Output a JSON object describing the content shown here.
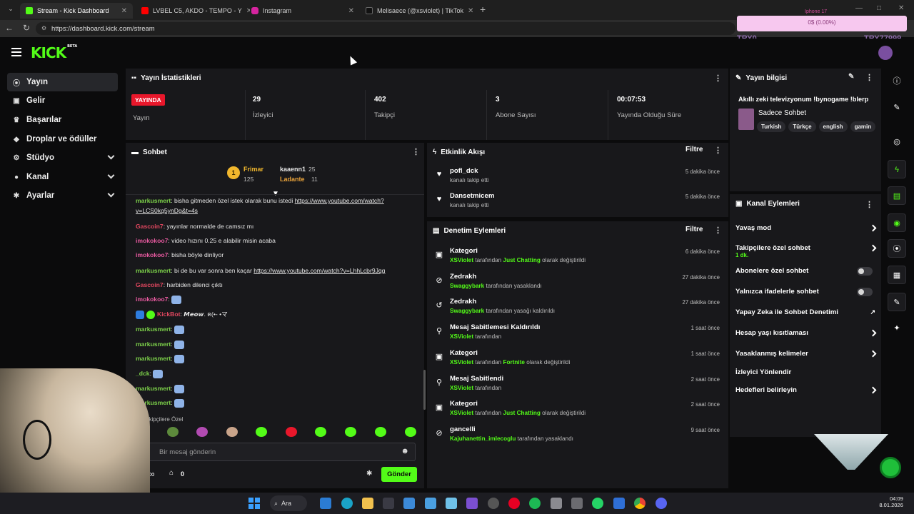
{
  "browser": {
    "tabs": [
      {
        "title": "Stream - Kick Dashboard",
        "active": true
      },
      {
        "title": "LVBEL C5, AKDO - TEMPO - Y",
        "active": false
      },
      {
        "title": "Instagram",
        "active": false
      },
      {
        "title": "Melisaece (@xsviolet) | TikTok",
        "active": false
      }
    ],
    "url": "https://dashboard.kick.com/stream"
  },
  "overlay": {
    "top_label": "Iphone 17",
    "progress_text": "0$ (0.00%)",
    "progress": 0,
    "left_name": "TRY0",
    "right_name": "TRY77999"
  },
  "app": {
    "logo": "KICK",
    "logo_badge": "BETA"
  },
  "sidebar": {
    "items": [
      {
        "label": "Yayın",
        "icon": "broadcast-icon",
        "active": true
      },
      {
        "label": "Gelir",
        "icon": "money-icon"
      },
      {
        "label": "Başarılar",
        "icon": "trophy-icon"
      },
      {
        "label": "Droplar ve ödüller",
        "icon": "gift-icon"
      },
      {
        "label": "Stüdyo",
        "icon": "studio-icon",
        "expandable": true
      },
      {
        "label": "Kanal",
        "icon": "person-icon",
        "expandable": true
      },
      {
        "label": "Ayarlar",
        "icon": "gear-icon",
        "expandable": true
      }
    ]
  },
  "stats": {
    "title": "Yayın İstatistikleri",
    "live_badge": "YAYINDA",
    "live_label": "Yayın",
    "items": [
      {
        "value": "29",
        "label": "İzleyici"
      },
      {
        "value": "402",
        "label": "Takipçi"
      },
      {
        "value": "3",
        "label": "Abone Sayısı"
      },
      {
        "value": "00:07:53",
        "label": "Yayında Olduğu Süre"
      }
    ]
  },
  "chat": {
    "title": "Sohbet",
    "leaderboard": [
      {
        "rank": "1",
        "name": "Frimar",
        "count": "125"
      },
      {
        "name": "kaaenn1",
        "count": "25"
      },
      {
        "name": "Ladante",
        "count": "11"
      }
    ],
    "messages": [
      {
        "user": "markusmert",
        "color": "#7dd24a",
        "text": "bisha gitmeden özel istek olarak bunu istedi ",
        "link": "https://www.youtube.com/watch?v=LCS0kq5ynDg&t=4s"
      },
      {
        "user": "Gascoin7",
        "color": "#e0475f",
        "text": "yayınlar normalde de camsız mı"
      },
      {
        "user": "imokokoo7",
        "color": "#e85aa0",
        "text": "video hızını 0.25 e alabilir misin acaba"
      },
      {
        "user": "imokokoo7",
        "color": "#e85aa0",
        "text": "bisha böyle dinliyor"
      },
      {
        "user": "markusmert",
        "color": "#7dd24a",
        "text": "bi de bu var sonra ben kaçar ",
        "link": "https://www.youtube.com/watch?v=LhhLcbr9Jqg"
      },
      {
        "user": "Gascoin7",
        "color": "#e0475f",
        "text": "harbiden dilenci çıktı"
      },
      {
        "user": "imokokoo7",
        "color": "#e85aa0",
        "text": "",
        "emote": true
      },
      {
        "user": "KickBot",
        "color": "#e0475f",
        "text": "𝙈𝙚𝙤𝙬. ฅ(•- •マ",
        "bot": true
      },
      {
        "user": "markusmert",
        "color": "#7dd24a",
        "text": "",
        "emote": true
      },
      {
        "user": "markusmert",
        "color": "#7dd24a",
        "text": "",
        "emote": true
      },
      {
        "user": "markusmert",
        "color": "#7dd24a",
        "text": "",
        "emote": true
      },
      {
        "user": "_dck",
        "color": "#7dd24a",
        "text": "",
        "emote": true
      },
      {
        "user": "markusmert",
        "color": "#7dd24a",
        "text": "",
        "emote": true
      },
      {
        "user": "markusmert",
        "color": "#7dd24a",
        "text": "",
        "emote": true
      }
    ],
    "mode_label": "akipçilere Özel",
    "input_placeholder": "Bir mesaj gönderin",
    "points": "0",
    "send_label": "Gönder"
  },
  "activity": {
    "title": "Etkinlik Akışı",
    "filter_label": "Filtre",
    "items": [
      {
        "user": "pofl_dck",
        "desc": "kanalı takip etti",
        "time": "5 dakika önce"
      },
      {
        "user": "Dansetmicem",
        "desc": "kanalı takip etti",
        "time": "5 dakika önce"
      }
    ]
  },
  "moderation": {
    "title": "Denetim Eylemleri",
    "filter_label": "Filtre",
    "items": [
      {
        "icon": "category-icon",
        "title": "Kategori",
        "actor": "XSViolet",
        "mid": "tarafından",
        "extra": "Just Chatting",
        "tail": "olarak değiştirildi",
        "time": "6 dakika önce"
      },
      {
        "icon": "ban-icon",
        "title": "Zedrakh",
        "actor": "Swaggybark",
        "mid": "tarafından yasaklandı",
        "extra": "",
        "tail": "",
        "time": "27 dakika önce"
      },
      {
        "icon": "unban-icon",
        "title": "Zedrakh",
        "actor": "Swaggybark",
        "mid": "tarafından yasağı kaldırıldı",
        "extra": "",
        "tail": "",
        "time": "27 dakika önce"
      },
      {
        "icon": "unpin-icon",
        "title": "Mesaj Sabitlemesi Kaldırıldı",
        "actor": "XSViolet",
        "mid": "tarafından",
        "extra": "",
        "tail": "",
        "time": "1 saat önce"
      },
      {
        "icon": "category-icon",
        "title": "Kategori",
        "actor": "XSViolet",
        "mid": "tarafından",
        "extra": "Fortnite",
        "tail": "olarak değiştirildi",
        "time": "1 saat önce"
      },
      {
        "icon": "pin-icon",
        "title": "Mesaj Sabitlendi",
        "actor": "XSViolet",
        "mid": "tarafından",
        "extra": "",
        "tail": "",
        "time": "2 saat önce"
      },
      {
        "icon": "category-icon",
        "title": "Kategori",
        "actor": "XSViolet",
        "mid": "tarafından",
        "extra": "Just Chatting",
        "tail": "olarak değiştirildi",
        "time": "2 saat önce"
      },
      {
        "icon": "ban-icon",
        "title": "gancelli",
        "actor": "Kajuhanettin_imlecoglu",
        "mid": "tarafından yasaklandı",
        "extra": "",
        "tail": "",
        "time": "9 saat önce"
      }
    ]
  },
  "stream_info": {
    "title": "Yayın bilgisi",
    "stream_title": "Akıllı zeki televizyonum !bynogame !blerp",
    "category": "Sadece Sohbet",
    "tags": [
      "Turkish",
      "Türkçe",
      "english",
      "gamin"
    ]
  },
  "channel_actions": {
    "title": "Kanal Eylemleri",
    "items": [
      {
        "label": "Yavaş mod",
        "control": "arrow"
      },
      {
        "label": "Takipçilere özel sohbet",
        "sub": "1 dk.",
        "control": "arrow"
      },
      {
        "label": "Abonelere özel sohbet",
        "control": "toggle"
      },
      {
        "label": "Yalnızca ifadelerle sohbet",
        "control": "toggle"
      },
      {
        "label": "Yapay Zeka ile Sohbet Denetimi",
        "control": "external"
      },
      {
        "label": "Hesap yaşı kısıtlaması",
        "control": "arrow"
      },
      {
        "label": "Yasaklanmış kelimeler",
        "control": "arrow"
      },
      {
        "label": "İzleyici Yönlendir",
        "control": "none"
      },
      {
        "label": "Hedefleri belirleyin",
        "control": "arrow"
      }
    ]
  },
  "taskbar": {
    "search_label": "Ara",
    "time": "04:09",
    "date": "8.01.2026"
  },
  "colors": {
    "brand": "#53fc18",
    "live": "#e9172b",
    "panel": "#18181b",
    "bg": "#0b0b0c"
  }
}
